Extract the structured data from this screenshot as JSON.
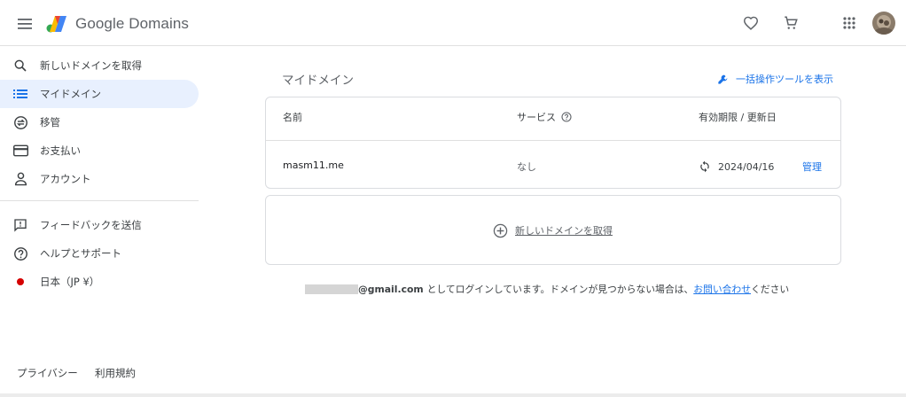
{
  "header": {
    "brand": "Google Domains",
    "icons": [
      "menu-icon",
      "google-domains-logo",
      "heart-icon",
      "cart-icon",
      "apps-icon",
      "avatar"
    ]
  },
  "sidebar": {
    "items": [
      {
        "label": "新しいドメインを取得",
        "icon": "search-icon"
      },
      {
        "label": "マイドメイン",
        "icon": "list-icon",
        "active": true
      },
      {
        "label": "移管",
        "icon": "transfer-icon"
      },
      {
        "label": "お支払い",
        "icon": "credit-card-icon"
      },
      {
        "label": "アカウント",
        "icon": "person-icon"
      },
      {
        "label": "フィードバックを送信",
        "icon": "feedback-icon"
      },
      {
        "label": "ヘルプとサポート",
        "icon": "help-icon"
      },
      {
        "label": "日本（JP ¥）",
        "icon": "japan-flag-icon"
      }
    ],
    "footer": {
      "privacy": "プライバシー",
      "terms": "利用規約"
    }
  },
  "main": {
    "title": "マイドメイン",
    "bulk_tool_label": "一括操作ツールを表示",
    "table": {
      "headers": {
        "name": "名前",
        "service": "サービス",
        "expiry": "有効期限 / 更新日"
      },
      "rows": [
        {
          "name": "masm11.me",
          "service": "なし",
          "expiry": "2024/04/16",
          "action": "管理"
        }
      ]
    },
    "get_new_domain_label": "新しいドメインを取得",
    "login_note": {
      "email_domain": "@gmail.com",
      "text": "としてログインしています。ドメインが見つからない場合は、",
      "link": "お問い合わせ",
      "suffix": "ください"
    }
  },
  "colors": {
    "accent": "#1a73e8",
    "active_bg": "#e8f0fe",
    "border": "#dadce0"
  }
}
